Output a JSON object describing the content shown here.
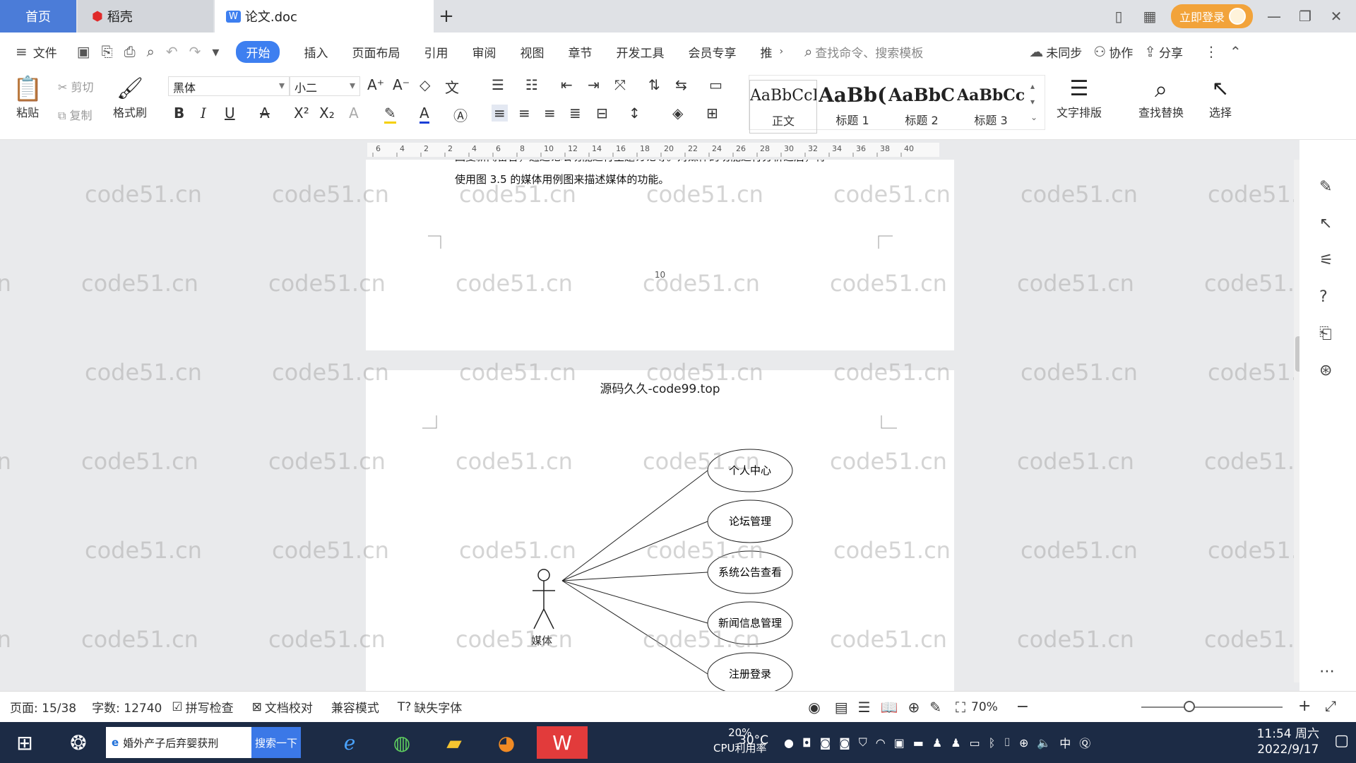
{
  "tabs": {
    "home": "首页",
    "daoke": "稻壳",
    "doc": "论文.doc"
  },
  "titlebar": {
    "login": "立即登录"
  },
  "menu": {
    "file": "文件",
    "items": [
      "开始",
      "插入",
      "页面布局",
      "引用",
      "审阅",
      "视图",
      "章节",
      "开发工具",
      "会员专享",
      "推"
    ],
    "search_cmd": "查找命令、搜索模板",
    "sync": "未同步",
    "collab": "协作",
    "share": "分享"
  },
  "ribbon": {
    "paste": "粘贴",
    "cut": "剪切",
    "copy": "复制",
    "format_painter": "格式刷",
    "font": "黑体",
    "size": "小二",
    "styles": [
      {
        "sample": "AaBbCcI",
        "name": "正文"
      },
      {
        "sample": "AaBb(",
        "name": "标题 1"
      },
      {
        "sample": "AaBbC",
        "name": "标题 2"
      },
      {
        "sample": "AaBbCcl",
        "name": "标题 3"
      }
    ],
    "text_layout": "文字排版",
    "find_replace": "查找替换",
    "select": "选择"
  },
  "ruler": {
    "ticks": [
      "6",
      "4",
      "2",
      "2",
      "4",
      "6",
      "8",
      "10",
      "12",
      "14",
      "16",
      "18",
      "20",
      "22",
      "24",
      "26",
      "28",
      "30",
      "32",
      "34",
      "36",
      "38",
      "40"
    ]
  },
  "document": {
    "para_line1": "回复新闻留言，通过论坛功能进行主题讨论等。对媒体的功能进行分析之后，将",
    "para_line2": "使用图 3.5 的媒体用例图来描述媒体的功能。",
    "page_number": "10",
    "header": "源码久久-code99.top",
    "actor": "媒体",
    "use_cases": [
      "个人中心",
      "论坛管理",
      "系统公告查看",
      "新闻信息管理",
      "注册登录"
    ]
  },
  "watermark": "code51.cn",
  "statusbar": {
    "page": "页面: 15/38",
    "words": "字数: 12740",
    "spell": "拼写检查",
    "proof": "文档校对",
    "compat": "兼容模式",
    "missing_font": "缺失字体",
    "zoom": "70%"
  },
  "taskbar": {
    "search_text": "婚外产子后弃婴获刑",
    "search_btn": "搜索一下",
    "cpu": "20%",
    "cpu_label": "CPU利用率",
    "temp": "30°C",
    "ime": "中",
    "time": "11:54 周六",
    "date": "2022/9/17"
  },
  "colors": {
    "accent": "#3d7ff0",
    "home_tab": "#4b7cd8",
    "login": "#f2a33a",
    "taskbar": "#1c2b45"
  }
}
